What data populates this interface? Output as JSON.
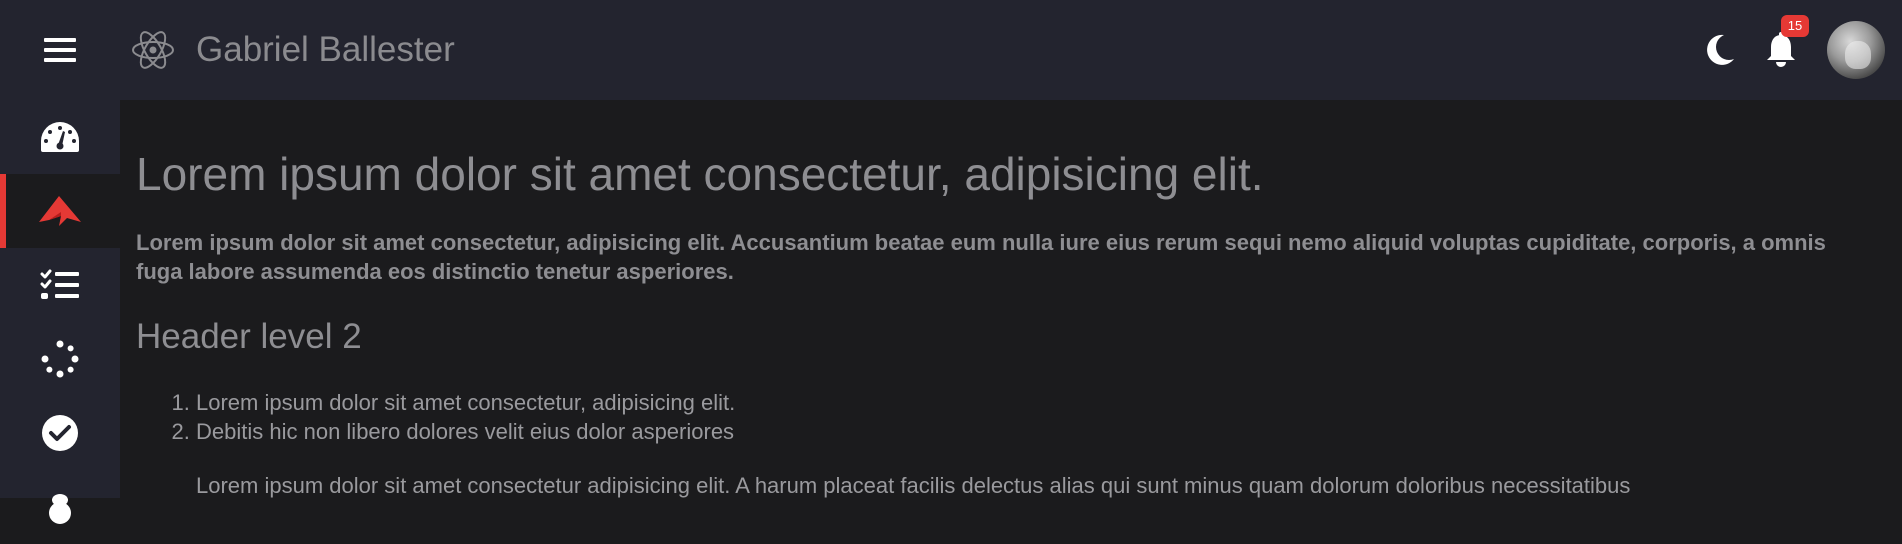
{
  "header": {
    "brand_title": "Gabriel Ballester",
    "notifications_count": "15",
    "icons": {
      "menu": "hamburger-menu-icon",
      "logo": "react-atom-icon",
      "theme": "moon-icon",
      "notifications": "bell-icon"
    }
  },
  "sidebar": {
    "items": [
      {
        "icon": "speedometer-icon",
        "active": false
      },
      {
        "icon": "paper-plane-icon",
        "active": true
      },
      {
        "icon": "checklist-icon",
        "active": false
      },
      {
        "icon": "loading-spinner-icon",
        "active": false
      },
      {
        "icon": "check-circle-icon",
        "active": false
      },
      {
        "icon": "bug-icon",
        "active": false
      }
    ]
  },
  "main": {
    "title": "Lorem ipsum dolor sit amet consectetur, adipisicing elit.",
    "lead": "Lorem ipsum dolor sit amet consectetur, adipisicing elit. Accusantium beatae eum nulla iure eius rerum sequi nemo aliquid voluptas cupiditate, corporis, a omnis fuga labore assumenda eos distinctio tenetur asperiores.",
    "subtitle": "Header level 2",
    "ordered_list": [
      "Lorem ipsum dolor sit amet consectetur, adipisicing elit.",
      "Debitis hic non libero dolores velit eius dolor asperiores"
    ],
    "paragraph": "Lorem ipsum dolor sit amet consectetur adipisicing elit. A harum placeat facilis delectus alias qui sunt minus quam dolorum doloribus necessitatibus"
  },
  "colors": {
    "header_bg": "#23242f",
    "content_bg": "#1b1b1d",
    "accent": "#e53935",
    "text": "#8e8e92"
  }
}
